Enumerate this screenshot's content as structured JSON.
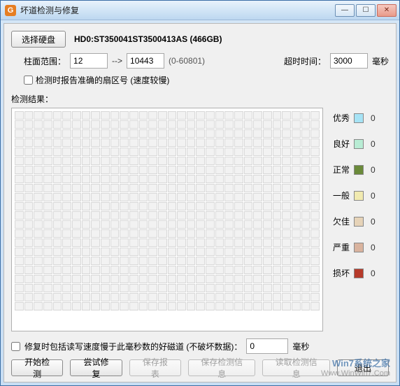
{
  "window": {
    "title": "坏道检测与修复"
  },
  "toolbar": {
    "select_disk": "选择硬盘",
    "disk_info": "HD0:ST350041ST3500413AS (466GB)"
  },
  "cylinder": {
    "label": "柱面范围：",
    "from": "12",
    "arrow": "-->",
    "to": "10443",
    "range_hint": "(0-60801)"
  },
  "timeout": {
    "label": "超时时间：",
    "value": "3000",
    "unit": "毫秒"
  },
  "options": {
    "accurate_sector_checkbox": "检测时报告准确的扇区号 (速度较慢)"
  },
  "result_label": "检测结果：",
  "legend": [
    {
      "name": "优秀",
      "color": "#a6e3f5",
      "count": "0"
    },
    {
      "name": "良好",
      "color": "#b8ecd4",
      "count": "0"
    },
    {
      "name": "正常",
      "color": "#6a8a3a",
      "count": "0"
    },
    {
      "name": "一般",
      "color": "#f1eab0",
      "count": "0"
    },
    {
      "name": "欠佳",
      "color": "#e6d3b8",
      "count": "0"
    },
    {
      "name": "严重",
      "color": "#d9b39e",
      "count": "0"
    },
    {
      "name": "损坏",
      "color": "#b63a2a",
      "count": "0"
    }
  ],
  "repair": {
    "checkbox_label": "修复时包括读写速度慢于此毫秒数的好磁道 (不破坏数据)：",
    "value": "0",
    "unit": "毫秒"
  },
  "buttons": {
    "start": "开始检测",
    "try_repair": "尝试修复",
    "save_report": "保存报表",
    "save_info": "保存检测信息",
    "load_info": "读取检测信息",
    "exit": "退出"
  },
  "watermark": {
    "line1": "Win7系统之家",
    "line2": "Www.WinWin7.Com"
  },
  "grid": {
    "rows": 22,
    "cols": 32
  }
}
